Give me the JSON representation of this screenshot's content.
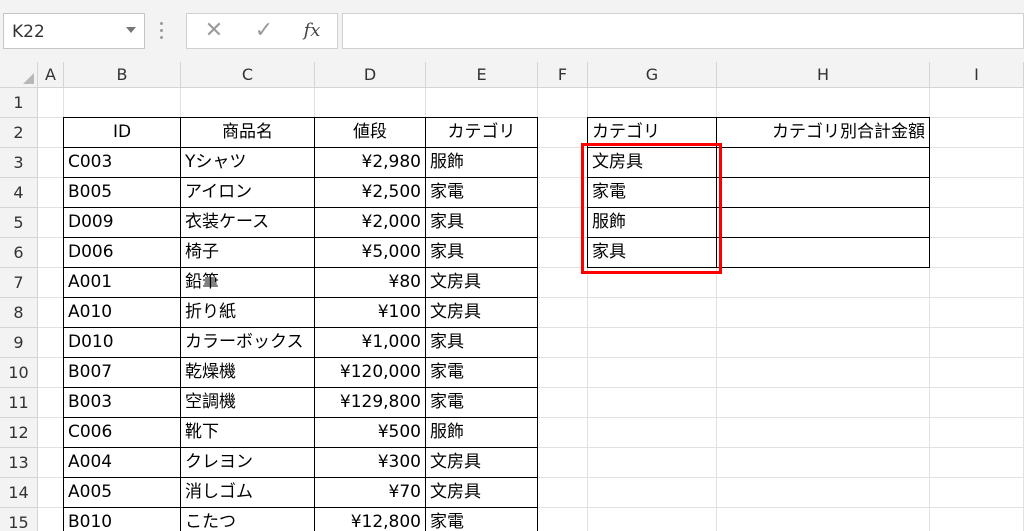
{
  "namebox": {
    "value": "K22"
  },
  "formula_bar": {
    "cancel_symbol": "✕",
    "enter_symbol": "✓",
    "fx_label": "fx",
    "content": ""
  },
  "columns": [
    "A",
    "B",
    "C",
    "D",
    "E",
    "F",
    "G",
    "H",
    "I"
  ],
  "rows": [
    "1",
    "2",
    "3",
    "4",
    "5",
    "6",
    "7",
    "8",
    "9",
    "10",
    "11",
    "12",
    "13",
    "14",
    "15"
  ],
  "table1": {
    "headers": [
      "ID",
      "商品名",
      "値段",
      "カテゴリ"
    ],
    "rows": [
      [
        "C003",
        "Yシャツ",
        "¥2,980",
        "服飾"
      ],
      [
        "B005",
        "アイロン",
        "¥2,500",
        "家電"
      ],
      [
        "D009",
        "衣装ケース",
        "¥2,000",
        "家具"
      ],
      [
        "D006",
        "椅子",
        "¥5,000",
        "家具"
      ],
      [
        "A001",
        "鉛筆",
        "¥80",
        "文房具"
      ],
      [
        "A010",
        "折り紙",
        "¥100",
        "文房具"
      ],
      [
        "D010",
        "カラーボックス",
        "¥1,000",
        "家具"
      ],
      [
        "B007",
        "乾燥機",
        "¥120,000",
        "家電"
      ],
      [
        "B003",
        "空調機",
        "¥129,800",
        "家電"
      ],
      [
        "C006",
        "靴下",
        "¥500",
        "服飾"
      ],
      [
        "A004",
        "クレヨン",
        "¥300",
        "文房具"
      ],
      [
        "A005",
        "消しゴム",
        "¥70",
        "文房具"
      ],
      [
        "B010",
        "こたつ",
        "¥12,800",
        "家電"
      ]
    ]
  },
  "table2": {
    "headers": [
      "カテゴリ",
      "カテゴリ別合計金額"
    ],
    "rows": [
      [
        "文房具",
        ""
      ],
      [
        "家電",
        ""
      ],
      [
        "服飾",
        ""
      ],
      [
        "家具",
        ""
      ]
    ]
  },
  "colors": {
    "highlight": "#ff0000",
    "header_bg": "#f3f3f3",
    "gridline": "#e1e1e1"
  }
}
